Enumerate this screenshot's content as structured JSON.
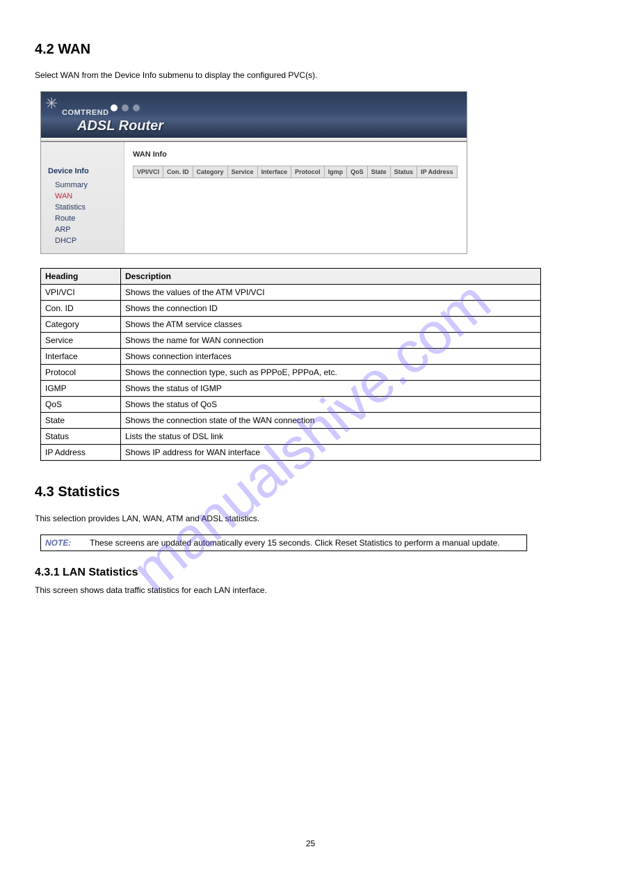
{
  "watermark": "manualshive.com",
  "page_number": "25",
  "section_wan": {
    "heading": "4.2 WAN",
    "intro": "Select WAN from the Device Info submenu to display the configured PVC(s).",
    "router": {
      "brand": "COMTREND",
      "title": "ADSL Router",
      "nav_heading": "Device Info",
      "nav_items": [
        "Summary",
        "WAN",
        "Statistics",
        "Route",
        "ARP",
        "DHCP"
      ],
      "main_title": "WAN Info",
      "wan_cols": [
        "VPI/VCI",
        "Con. ID",
        "Category",
        "Service",
        "Interface",
        "Protocol",
        "Igmp",
        "QoS",
        "State",
        "Status",
        "IP Address"
      ]
    },
    "desc_headers": [
      "Heading",
      "Description"
    ],
    "desc_rows": [
      [
        "VPI/VCI",
        "Shows the values of the ATM VPI/VCI"
      ],
      [
        "Con. ID",
        "Shows the connection ID"
      ],
      [
        "Category",
        "Shows the ATM service classes"
      ],
      [
        "Service",
        "Shows the name for WAN connection"
      ],
      [
        "Interface",
        "Shows connection interfaces"
      ],
      [
        "Protocol",
        "Shows the connection type, such as PPPoE, PPPoA, etc."
      ],
      [
        "IGMP",
        "Shows the status of IGMP"
      ],
      [
        "QoS",
        "Shows the status of QoS"
      ],
      [
        "State",
        "Shows the connection state of the WAN connection"
      ],
      [
        "Status",
        "Lists the status of DSL link"
      ],
      [
        "IP Address",
        "Shows IP address for WAN interface"
      ]
    ]
  },
  "section_stats": {
    "heading": "4.3 Statistics",
    "intro": "This selection provides LAN, WAN, ATM and ADSL statistics.",
    "note_label": "NOTE:",
    "note_text": "These screens are updated automatically every 15 seconds.  Click Reset Statistics to perform a manual update.",
    "sub_heading": "4.3.1 LAN Statistics",
    "sub_body": "This screen shows data traffic statistics for each LAN interface."
  }
}
